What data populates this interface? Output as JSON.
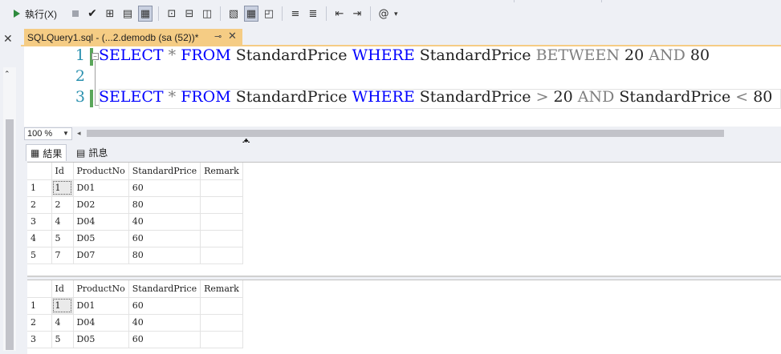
{
  "toolbar": {
    "execute_label": "執行(X)",
    "icons": [
      "stop-icon",
      "check-icon",
      "parse-plan-icon",
      "results-to-text-icon",
      "results-to-grid-icon",
      "results-to-file-icon",
      "include-plan-icon",
      "live-stats-icon",
      "client-stats-icon",
      "comment-icon",
      "uncomment-icon",
      "outdent-icon",
      "indent-icon",
      "specify-values-icon"
    ]
  },
  "tab": {
    "title": "SQLQuery1.sql - (...2.demodb (sa (52))*",
    "pin": "⊸",
    "close": "✕"
  },
  "editor": {
    "lines": [
      {
        "num": "1",
        "tokens": [
          {
            "t": "SELECT",
            "c": "kw"
          },
          {
            "t": " ",
            "c": ""
          },
          {
            "t": "*",
            "c": "op"
          },
          {
            "t": " ",
            "c": ""
          },
          {
            "t": "FROM",
            "c": "kw"
          },
          {
            "t": " StandardPrice ",
            "c": ""
          },
          {
            "t": "WHERE",
            "c": "kw"
          },
          {
            "t": " StandardPrice ",
            "c": ""
          },
          {
            "t": "BETWEEN",
            "c": "op"
          },
          {
            "t": " 20 ",
            "c": ""
          },
          {
            "t": "AND",
            "c": "op"
          },
          {
            "t": " 80",
            "c": ""
          }
        ]
      },
      {
        "num": "2",
        "tokens": []
      },
      {
        "num": "3",
        "tokens": [
          {
            "t": "SELECT",
            "c": "kw"
          },
          {
            "t": " ",
            "c": ""
          },
          {
            "t": "*",
            "c": "op"
          },
          {
            "t": " ",
            "c": ""
          },
          {
            "t": "FROM",
            "c": "kw"
          },
          {
            "t": " StandardPrice ",
            "c": ""
          },
          {
            "t": "WHERE",
            "c": "kw"
          },
          {
            "t": " StandardPrice ",
            "c": ""
          },
          {
            "t": ">",
            "c": "op"
          },
          {
            "t": " 20 ",
            "c": ""
          },
          {
            "t": "AND",
            "c": "op"
          },
          {
            "t": " StandardPrice ",
            "c": ""
          },
          {
            "t": "<",
            "c": "op"
          },
          {
            "t": " 80",
            "c": ""
          }
        ]
      }
    ]
  },
  "zoom": {
    "value": "100 %"
  },
  "results_tabs": {
    "results_label": "結果",
    "messages_label": "訊息"
  },
  "grid1": {
    "columns": [
      "Id",
      "ProductNo",
      "StandardPrice",
      "Remark"
    ],
    "rows": [
      [
        "1",
        "1",
        "D01",
        "60",
        ""
      ],
      [
        "2",
        "2",
        "D02",
        "80",
        ""
      ],
      [
        "3",
        "4",
        "D04",
        "40",
        ""
      ],
      [
        "4",
        "5",
        "D05",
        "60",
        ""
      ],
      [
        "5",
        "7",
        "D07",
        "80",
        ""
      ]
    ]
  },
  "grid2": {
    "columns": [
      "Id",
      "ProductNo",
      "StandardPrice",
      "Remark"
    ],
    "rows": [
      [
        "1",
        "1",
        "D01",
        "60",
        ""
      ],
      [
        "2",
        "4",
        "D04",
        "40",
        ""
      ],
      [
        "3",
        "5",
        "D05",
        "60",
        ""
      ]
    ]
  },
  "colors": {
    "keyword": "#0000ff",
    "operator": "#808080",
    "line_number": "#2b91af",
    "active_tab": "#f5cc84",
    "change_bar": "#5aa65a"
  }
}
